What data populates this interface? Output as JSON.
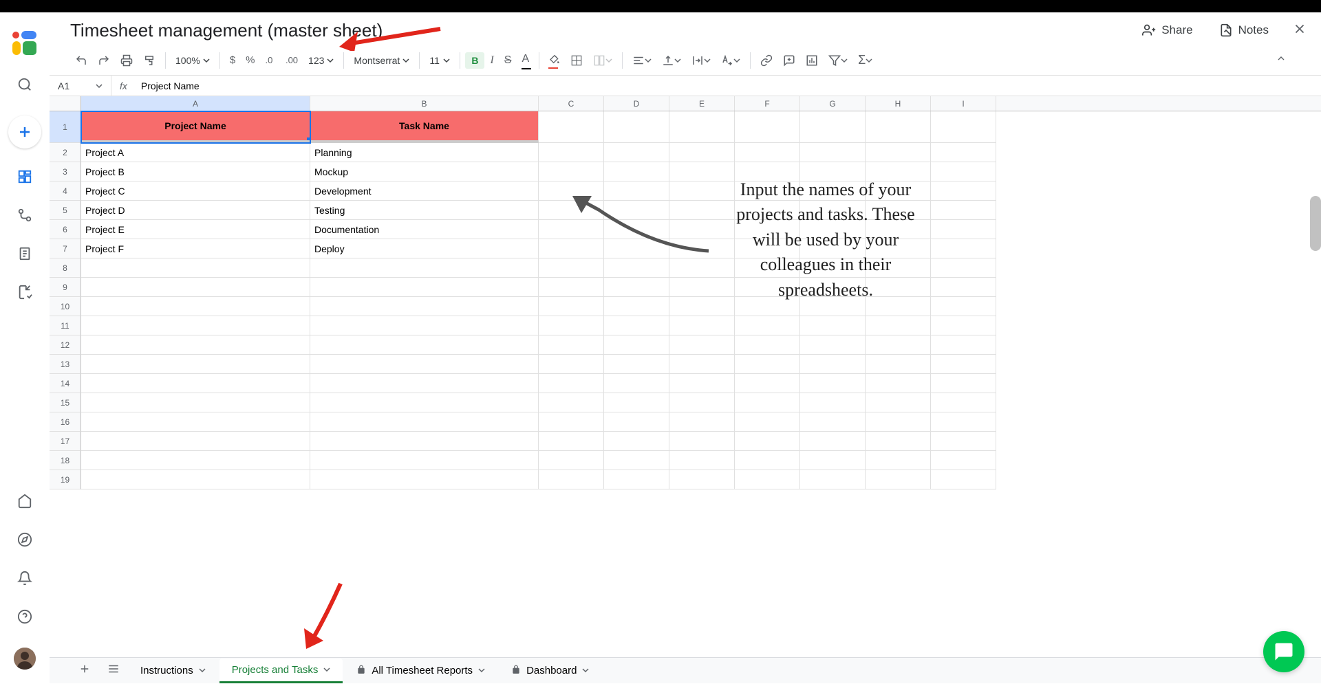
{
  "doc_title": "Timesheet management (master sheet)",
  "header": {
    "share": "Share",
    "notes": "Notes"
  },
  "toolbar": {
    "zoom": "100%",
    "font": "Montserrat",
    "fontsize": "11",
    "format_type": "123"
  },
  "formula_bar": {
    "cell_ref": "A1",
    "value": "Project Name"
  },
  "columns": [
    "A",
    "B",
    "C",
    "D",
    "E",
    "F",
    "G",
    "H",
    "I"
  ],
  "header_row": {
    "a": "Project Name",
    "b": "Task Name"
  },
  "rows": [
    {
      "a": "Project A",
      "b": "Planning"
    },
    {
      "a": "Project B",
      "b": "Mockup"
    },
    {
      "a": "Project C",
      "b": "Development"
    },
    {
      "a": "Project D",
      "b": "Testing"
    },
    {
      "a": "Project E",
      "b": "Documentation"
    },
    {
      "a": "Project F",
      "b": "Deploy"
    }
  ],
  "tabs": [
    {
      "label": "Instructions",
      "locked": false
    },
    {
      "label": "Projects and Tasks",
      "locked": false,
      "active": true
    },
    {
      "label": "All Timesheet Reports",
      "locked": true
    },
    {
      "label": "Dashboard",
      "locked": true
    }
  ],
  "annotation": "Input the names of your projects and tasks. These will be used by your colleagues in their spreadsheets."
}
